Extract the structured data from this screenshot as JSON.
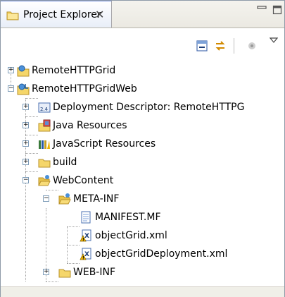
{
  "view": {
    "tab_title": "Project Explorer",
    "close_glyph": "✕"
  },
  "tree": {
    "items": [
      {
        "label": "RemoteHTTPGrid",
        "icon": "web-project-icon",
        "expanded": false
      },
      {
        "label": "RemoteHTTPGridWeb",
        "icon": "web-project-icon",
        "expanded": true
      },
      {
        "label": "Deployment Descriptor: RemoteHTTPG",
        "icon": "deployment-descriptor-icon",
        "expanded": false
      },
      {
        "label": "Java Resources",
        "icon": "java-resources-icon",
        "expanded": false
      },
      {
        "label": "JavaScript Resources",
        "icon": "javascript-resources-icon",
        "expanded": false
      },
      {
        "label": "build",
        "icon": "folder-icon",
        "expanded": false
      },
      {
        "label": "WebContent",
        "icon": "folder-open-icon",
        "expanded": true
      },
      {
        "label": "META-INF",
        "icon": "folder-open-icon",
        "expanded": true
      },
      {
        "label": "MANIFEST.MF",
        "icon": "text-file-icon"
      },
      {
        "label": "objectGrid.xml",
        "icon": "xml-file-warning-icon"
      },
      {
        "label": "objectGridDeployment.xml",
        "icon": "xml-file-warning-icon"
      },
      {
        "label": "WEB-INF",
        "icon": "folder-icon",
        "expanded": false
      }
    ]
  },
  "colors": {
    "tab_border": "#7a96df",
    "folder": "#f5d66a",
    "warning": "#f0b400",
    "tree_lines": "#a0a0a0"
  }
}
